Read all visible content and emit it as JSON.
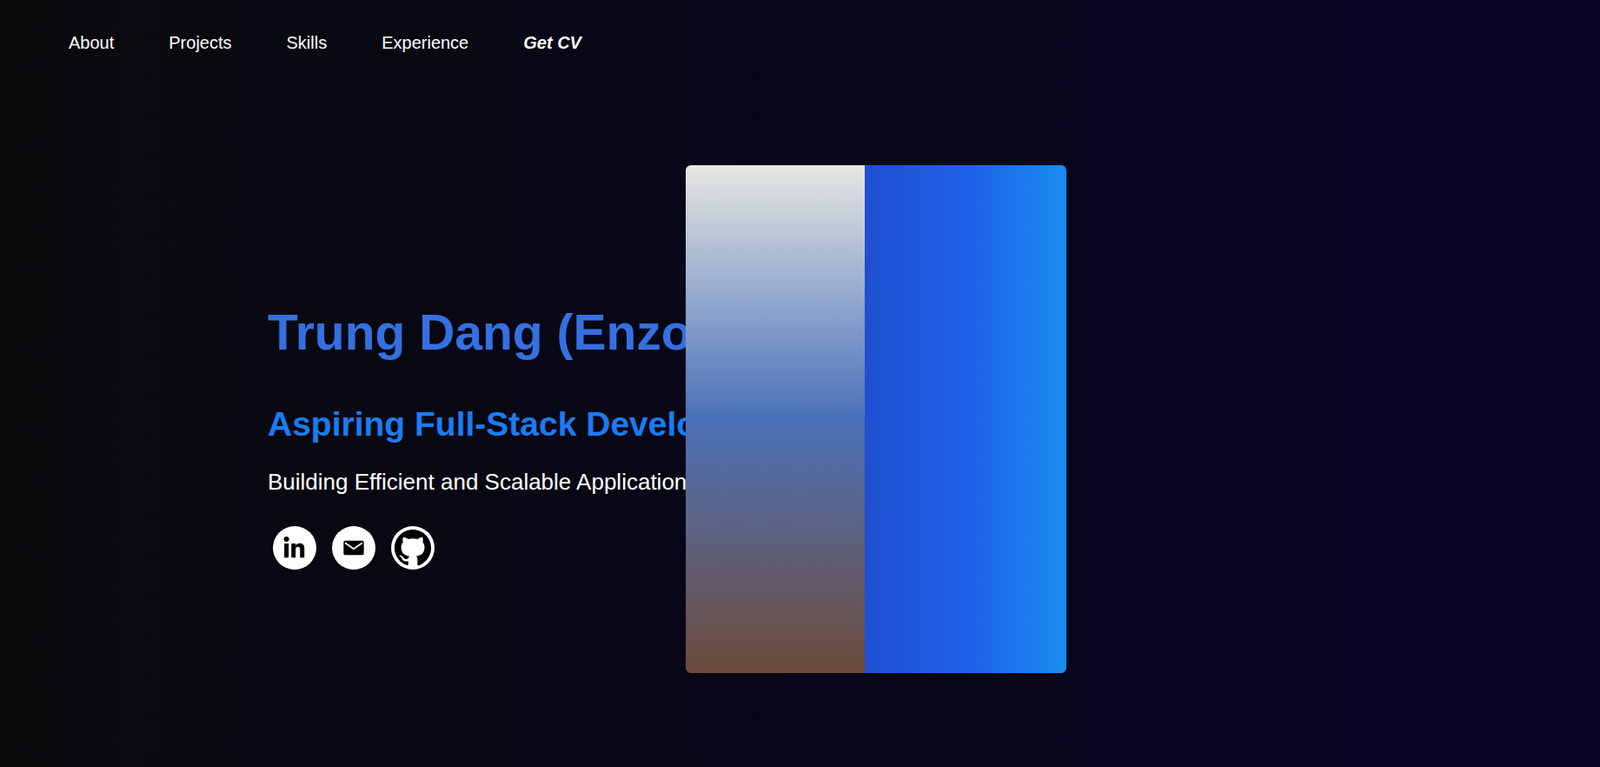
{
  "nav": [
    {
      "label": "About",
      "kind": "link"
    },
    {
      "label": "Projects",
      "kind": "link"
    },
    {
      "label": "Skills",
      "kind": "link"
    },
    {
      "label": "Experience",
      "kind": "link"
    },
    {
      "label": "Get CV",
      "kind": "cv"
    }
  ],
  "hero": {
    "name": "Trung Dang (Enzo)",
    "role": "Aspiring Full-Stack Developer",
    "tagline": "Building Efficient and Scalable Applications"
  }
}
